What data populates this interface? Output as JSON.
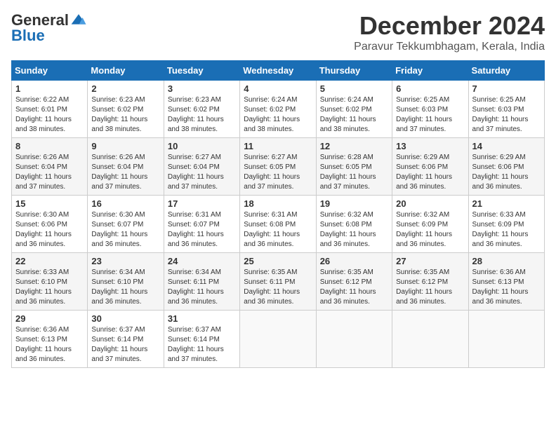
{
  "logo": {
    "general": "General",
    "blue": "Blue"
  },
  "title": {
    "month": "December 2024",
    "location": "Paravur Tekkumbhagam, Kerala, India"
  },
  "headers": [
    "Sunday",
    "Monday",
    "Tuesday",
    "Wednesday",
    "Thursday",
    "Friday",
    "Saturday"
  ],
  "weeks": [
    [
      {
        "day": "1",
        "sunrise": "6:22 AM",
        "sunset": "6:01 PM",
        "daylight": "11 hours and 38 minutes."
      },
      {
        "day": "2",
        "sunrise": "6:23 AM",
        "sunset": "6:02 PM",
        "daylight": "11 hours and 38 minutes."
      },
      {
        "day": "3",
        "sunrise": "6:23 AM",
        "sunset": "6:02 PM",
        "daylight": "11 hours and 38 minutes."
      },
      {
        "day": "4",
        "sunrise": "6:24 AM",
        "sunset": "6:02 PM",
        "daylight": "11 hours and 38 minutes."
      },
      {
        "day": "5",
        "sunrise": "6:24 AM",
        "sunset": "6:02 PM",
        "daylight": "11 hours and 38 minutes."
      },
      {
        "day": "6",
        "sunrise": "6:25 AM",
        "sunset": "6:03 PM",
        "daylight": "11 hours and 37 minutes."
      },
      {
        "day": "7",
        "sunrise": "6:25 AM",
        "sunset": "6:03 PM",
        "daylight": "11 hours and 37 minutes."
      }
    ],
    [
      {
        "day": "8",
        "sunrise": "6:26 AM",
        "sunset": "6:04 PM",
        "daylight": "11 hours and 37 minutes."
      },
      {
        "day": "9",
        "sunrise": "6:26 AM",
        "sunset": "6:04 PM",
        "daylight": "11 hours and 37 minutes."
      },
      {
        "day": "10",
        "sunrise": "6:27 AM",
        "sunset": "6:04 PM",
        "daylight": "11 hours and 37 minutes."
      },
      {
        "day": "11",
        "sunrise": "6:27 AM",
        "sunset": "6:05 PM",
        "daylight": "11 hours and 37 minutes."
      },
      {
        "day": "12",
        "sunrise": "6:28 AM",
        "sunset": "6:05 PM",
        "daylight": "11 hours and 37 minutes."
      },
      {
        "day": "13",
        "sunrise": "6:29 AM",
        "sunset": "6:06 PM",
        "daylight": "11 hours and 36 minutes."
      },
      {
        "day": "14",
        "sunrise": "6:29 AM",
        "sunset": "6:06 PM",
        "daylight": "11 hours and 36 minutes."
      }
    ],
    [
      {
        "day": "15",
        "sunrise": "6:30 AM",
        "sunset": "6:06 PM",
        "daylight": "11 hours and 36 minutes."
      },
      {
        "day": "16",
        "sunrise": "6:30 AM",
        "sunset": "6:07 PM",
        "daylight": "11 hours and 36 minutes."
      },
      {
        "day": "17",
        "sunrise": "6:31 AM",
        "sunset": "6:07 PM",
        "daylight": "11 hours and 36 minutes."
      },
      {
        "day": "18",
        "sunrise": "6:31 AM",
        "sunset": "6:08 PM",
        "daylight": "11 hours and 36 minutes."
      },
      {
        "day": "19",
        "sunrise": "6:32 AM",
        "sunset": "6:08 PM",
        "daylight": "11 hours and 36 minutes."
      },
      {
        "day": "20",
        "sunrise": "6:32 AM",
        "sunset": "6:09 PM",
        "daylight": "11 hours and 36 minutes."
      },
      {
        "day": "21",
        "sunrise": "6:33 AM",
        "sunset": "6:09 PM",
        "daylight": "11 hours and 36 minutes."
      }
    ],
    [
      {
        "day": "22",
        "sunrise": "6:33 AM",
        "sunset": "6:10 PM",
        "daylight": "11 hours and 36 minutes."
      },
      {
        "day": "23",
        "sunrise": "6:34 AM",
        "sunset": "6:10 PM",
        "daylight": "11 hours and 36 minutes."
      },
      {
        "day": "24",
        "sunrise": "6:34 AM",
        "sunset": "6:11 PM",
        "daylight": "11 hours and 36 minutes."
      },
      {
        "day": "25",
        "sunrise": "6:35 AM",
        "sunset": "6:11 PM",
        "daylight": "11 hours and 36 minutes."
      },
      {
        "day": "26",
        "sunrise": "6:35 AM",
        "sunset": "6:12 PM",
        "daylight": "11 hours and 36 minutes."
      },
      {
        "day": "27",
        "sunrise": "6:35 AM",
        "sunset": "6:12 PM",
        "daylight": "11 hours and 36 minutes."
      },
      {
        "day": "28",
        "sunrise": "6:36 AM",
        "sunset": "6:13 PM",
        "daylight": "11 hours and 36 minutes."
      }
    ],
    [
      {
        "day": "29",
        "sunrise": "6:36 AM",
        "sunset": "6:13 PM",
        "daylight": "11 hours and 36 minutes."
      },
      {
        "day": "30",
        "sunrise": "6:37 AM",
        "sunset": "6:14 PM",
        "daylight": "11 hours and 37 minutes."
      },
      {
        "day": "31",
        "sunrise": "6:37 AM",
        "sunset": "6:14 PM",
        "daylight": "11 hours and 37 minutes."
      },
      null,
      null,
      null,
      null
    ]
  ]
}
